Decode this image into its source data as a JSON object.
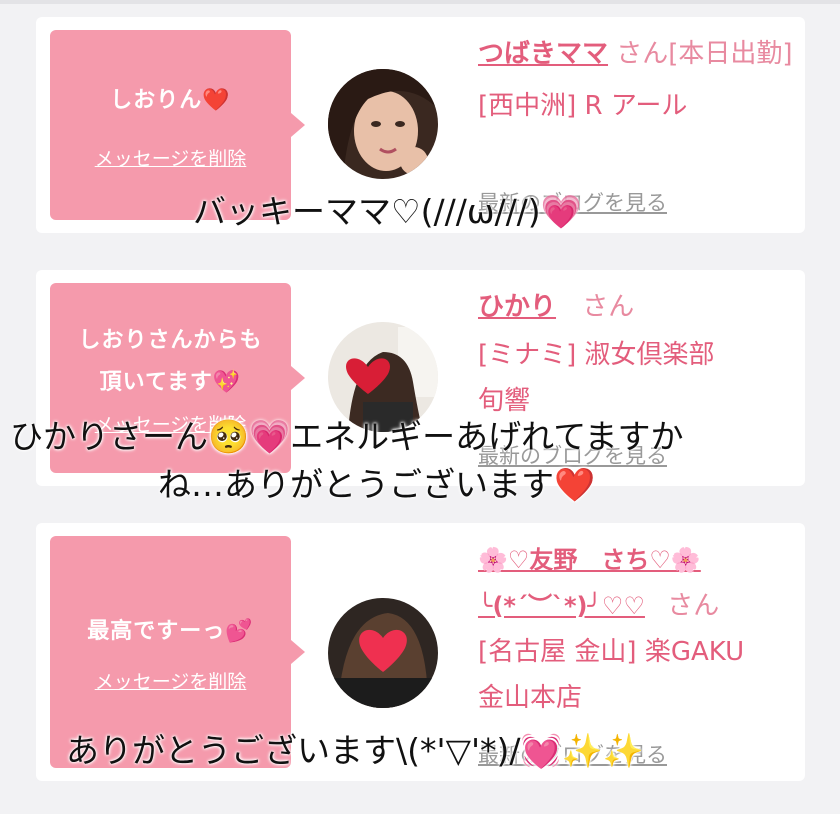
{
  "cards": [
    {
      "bubble_text": "しおりん❤️",
      "delete_label": "メッセージを削除",
      "name": "つばきママ",
      "honorific": "さん[本日出勤]",
      "shop_line": "[西中洲] R アール",
      "blog_label": "最新のブログを見る",
      "overlay": "バッキーママ♡(///ω///)💗"
    },
    {
      "bubble_text": "しおりさんからも\n頂いてます💖",
      "delete_label": "メッセージを削除",
      "name": "ひかり",
      "honorific": "さん",
      "shop_line": "[ミナミ] 淑女倶楽部\n旬響",
      "blog_label": "最新のブログを見る",
      "overlay_line1": "ひかりさーん🥺💗エネルギーあげれてますか",
      "overlay_line2": "ね…ありがとうございます❤️"
    },
    {
      "bubble_text": "最高ですーっ💕",
      "delete_label": "メッセージを削除",
      "name": "🌸♡友野　さち♡🌸\n╰(*´︶`*)╯♡♡",
      "honorific": "さん",
      "shop_line": "[名古屋 金山] 楽GAKU\n金山本店",
      "blog_label": "最新のブログを見る",
      "overlay": "ありがとうございます\\(*'▽'*)/💓✨✨"
    }
  ],
  "colors": {
    "bubble": "#f59aac",
    "name_text": "#e35d7c",
    "background": "#f2f2f4"
  }
}
